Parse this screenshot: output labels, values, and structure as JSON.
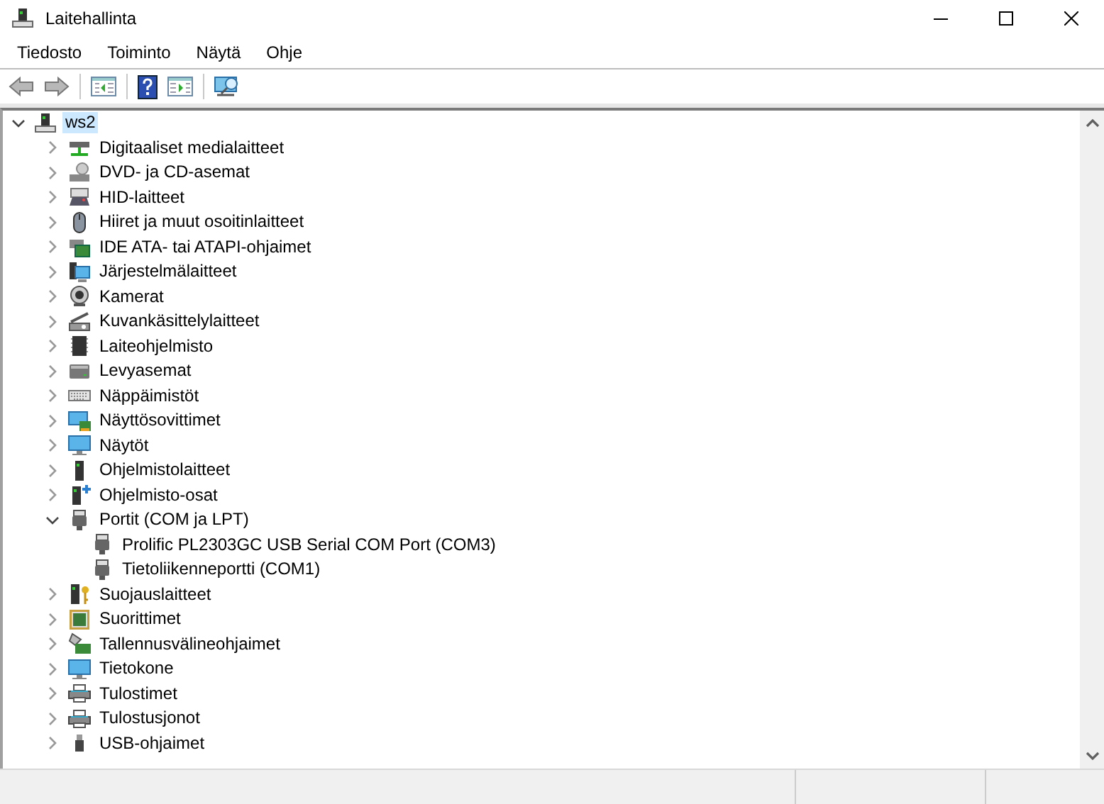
{
  "window": {
    "title": "Laitehallinta"
  },
  "menu": [
    "Tiedosto",
    "Toiminto",
    "Näytä",
    "Ohje"
  ],
  "tree": [
    {
      "label": "ws2",
      "selected": true,
      "expanded": true,
      "children": [
        {
          "label": "Digitaaliset medialaitteet",
          "selected": false,
          "expanded": false
        },
        {
          "label": "DVD- ja CD-asemat",
          "selected": false,
          "expanded": false
        },
        {
          "label": "HID-laitteet",
          "selected": false,
          "expanded": false
        },
        {
          "label": "Hiiret ja muut osoitinlaitteet",
          "selected": false,
          "expanded": false
        },
        {
          "label": "IDE ATA- tai ATAPI-ohjaimet",
          "selected": false,
          "expanded": false
        },
        {
          "label": "Järjestelmälaitteet",
          "selected": false,
          "expanded": false
        },
        {
          "label": "Kamerat",
          "selected": false,
          "expanded": false
        },
        {
          "label": "Kuvankäsittelylaitteet",
          "selected": false,
          "expanded": false
        },
        {
          "label": "Laiteohjelmisto",
          "selected": false,
          "expanded": false
        },
        {
          "label": "Levyasemat",
          "selected": false,
          "expanded": false
        },
        {
          "label": "Näppäimistöt",
          "selected": false,
          "expanded": false
        },
        {
          "label": "Näyttösovittimet",
          "selected": false,
          "expanded": false
        },
        {
          "label": "Näytöt",
          "selected": false,
          "expanded": false
        },
        {
          "label": "Ohjelmistolaitteet",
          "selected": false,
          "expanded": false
        },
        {
          "label": "Ohjelmisto-osat",
          "selected": false,
          "expanded": false
        },
        {
          "label": "Portit (COM ja LPT)",
          "selected": false,
          "expanded": true,
          "children": [
            {
              "label": "Prolific PL2303GC USB Serial COM Port (COM3)",
              "selected": false
            },
            {
              "label": "Tietoliikenneportti (COM1)",
              "selected": false
            }
          ]
        },
        {
          "label": "Suojauslaitteet",
          "selected": false,
          "expanded": false
        },
        {
          "label": "Suorittimet",
          "selected": false,
          "expanded": false
        },
        {
          "label": "Tallennusvälineohjaimet",
          "selected": false,
          "expanded": false
        },
        {
          "label": "Tietokone",
          "selected": false,
          "expanded": false
        },
        {
          "label": "Tulostimet",
          "selected": false,
          "expanded": false
        },
        {
          "label": "Tulostusjonot",
          "selected": false,
          "expanded": false
        },
        {
          "label": "USB-ohjaimet",
          "selected": false,
          "expanded": false
        }
      ]
    }
  ]
}
